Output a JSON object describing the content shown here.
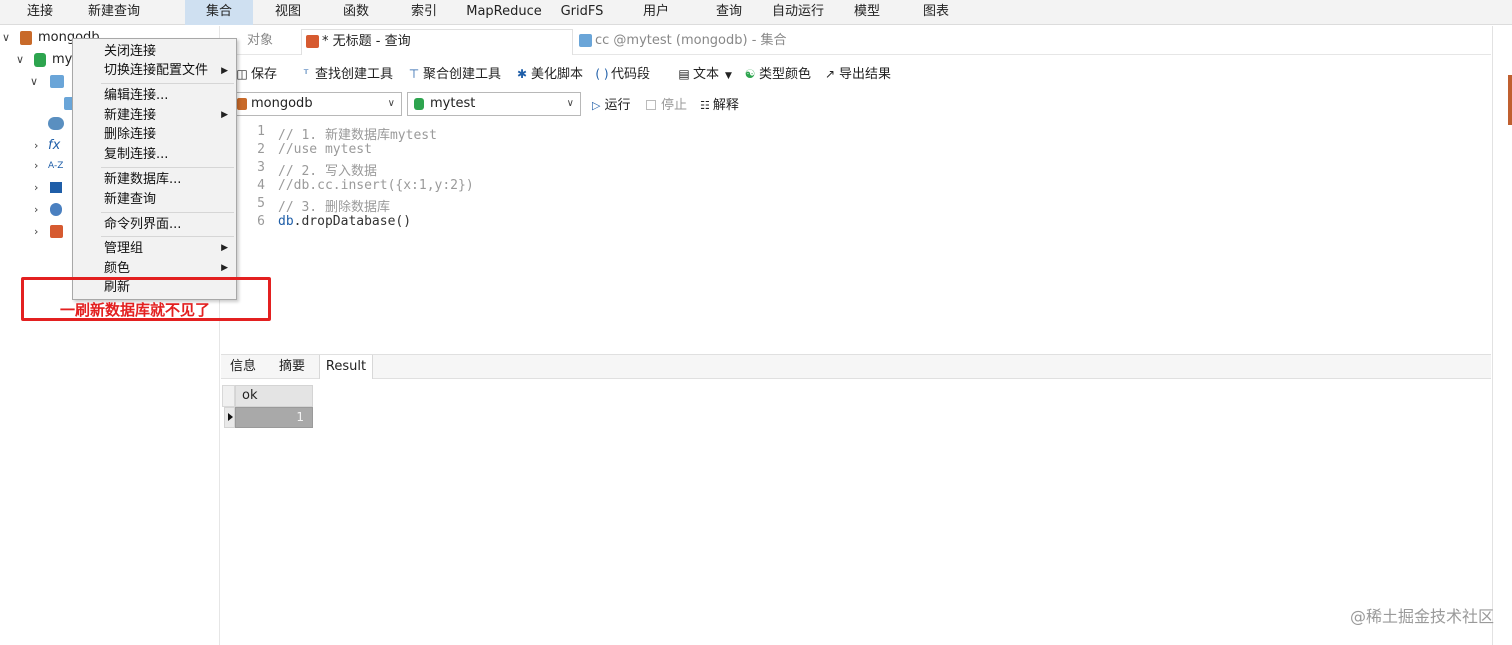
{
  "menubar": {
    "items": [
      "连接",
      "新建查询",
      "集合",
      "视图",
      "函数",
      "索引",
      "MapReduce",
      "GridFS",
      "用户",
      "查询",
      "自动运行",
      "模型",
      "图表"
    ],
    "active_index": 2
  },
  "sidebar": {
    "root_label": "mongodb",
    "db_label": "my",
    "sub_labels": [
      "集",
      "",
      "视",
      "fx 函",
      "索",
      "G",
      "查"
    ]
  },
  "tabs": {
    "objects": "对象",
    "query": "* 无标题 - 查询",
    "collection": "cc @mytest (mongodb) - 集合"
  },
  "toolbar": {
    "save": "保存",
    "find_builder": "查找创建工具",
    "aggregate_builder": "聚合创建工具",
    "beautify": "美化脚本",
    "snippet": "代码段",
    "text": "文本",
    "type_color": "类型颜色",
    "export": "导出结果"
  },
  "connection_select": {
    "value": "mongodb"
  },
  "database_select": {
    "value": "mytest"
  },
  "run_bar": {
    "run": "运行",
    "stop": "停止",
    "explain": "解释"
  },
  "editor": {
    "lines": [
      {
        "no": "1",
        "text": "// 1. 新建数据库mytest"
      },
      {
        "no": "2",
        "text": "//use mytest"
      },
      {
        "no": "3",
        "text": "// 2. 写入数据"
      },
      {
        "no": "4",
        "text": "//db.cc.insert({x:1,y:2})"
      },
      {
        "no": "5",
        "text": "// 3. 删除数据库"
      },
      {
        "no": "6",
        "text": "db.dropDatabase()"
      }
    ],
    "line6_kw": "db",
    "line6_rest": ".dropDatabase()"
  },
  "result_tabs": [
    "信息",
    "摘要",
    "Result"
  ],
  "result_grid": {
    "column": "ok",
    "value": "1"
  },
  "context_menu": {
    "items": [
      "关闭连接",
      "切换连接配置文件",
      "编辑连接...",
      "新建连接",
      "删除连接",
      "复制连接...",
      "新建数据库...",
      "新建查询",
      "命令列界面...",
      "管理组",
      "颜色",
      "刷新"
    ]
  },
  "annotation": {
    "text": "一刷新数据库就不见了"
  },
  "watermark": "@稀土掘金技术社区",
  "colors": {
    "annotation": "#e32020",
    "active_menu": "#cfe0f1",
    "db_green": "#2da44e"
  }
}
